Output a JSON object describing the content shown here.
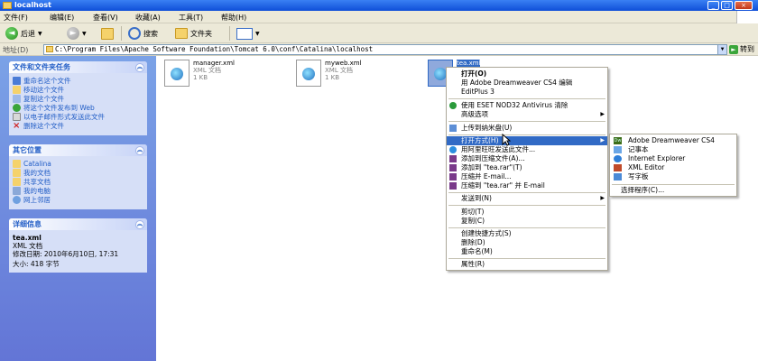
{
  "window": {
    "title": "localhost"
  },
  "menubar": [
    {
      "label": "文件(F)"
    },
    {
      "label": "编辑(E)"
    },
    {
      "label": "查看(V)"
    },
    {
      "label": "收藏(A)"
    },
    {
      "label": "工具(T)"
    },
    {
      "label": "帮助(H)"
    }
  ],
  "toolbar": {
    "back": "后退",
    "search": "搜索",
    "folders": "文件夹"
  },
  "address": {
    "label": "地址(D)",
    "path": "C:\\Program Files\\Apache Software Foundation\\Tomcat 6.0\\conf\\Catalina\\localhost",
    "go": "转到"
  },
  "sidebar": {
    "tasks": {
      "title": "文件和文件夹任务",
      "items": [
        "重命名这个文件",
        "移动这个文件",
        "复制这个文件",
        "将这个文件发布到 Web",
        "以电子邮件形式发送此文件",
        "删除这个文件"
      ]
    },
    "places": {
      "title": "其它位置",
      "items": [
        "Catalina",
        "我的文档",
        "共享文档",
        "我的电脑",
        "网上邻居"
      ]
    },
    "details": {
      "title": "详细信息",
      "name": "tea.xml",
      "type": "XML 文档",
      "modified": "修改日期: 2010年6月10日, 17:31",
      "size": "大小: 418 字节"
    }
  },
  "files": [
    {
      "name": "manager.xml",
      "type": "XML 文档",
      "size": "1 KB"
    },
    {
      "name": "myweb.xml",
      "type": "XML 文档",
      "size": "1 KB"
    },
    {
      "name": "tea.xml",
      "type": "",
      "size": ""
    }
  ],
  "context_menu": {
    "items": [
      "打开(O)",
      "用 Adobe Dreamweaver CS4 编辑",
      "EditPlus 3",
      "使用 ESET NOD32 Antivirus 清除",
      "高级选项",
      "上传到纳米盘(U)",
      "打开方式(H)",
      "用阿里旺旺发送此文件...",
      "添加到压缩文件(A)...",
      "添加到 \"tea.rar\"(T)",
      "压缩并 E-mail...",
      "压缩到 \"tea.rar\" 并 E-mail",
      "发送到(N)",
      "剪切(T)",
      "复制(C)",
      "创建快捷方式(S)",
      "删除(D)",
      "重命名(M)",
      "属性(R)"
    ]
  },
  "open_with_menu": {
    "items": [
      "Adobe Dreamweaver CS4",
      "记事本",
      "Internet Explorer",
      "XML Editor",
      "写字板",
      "选择程序(C)..."
    ]
  },
  "colors": {
    "selection": "#316ac5",
    "sidebar": "#7ba2e7",
    "link": "#215dc6"
  }
}
